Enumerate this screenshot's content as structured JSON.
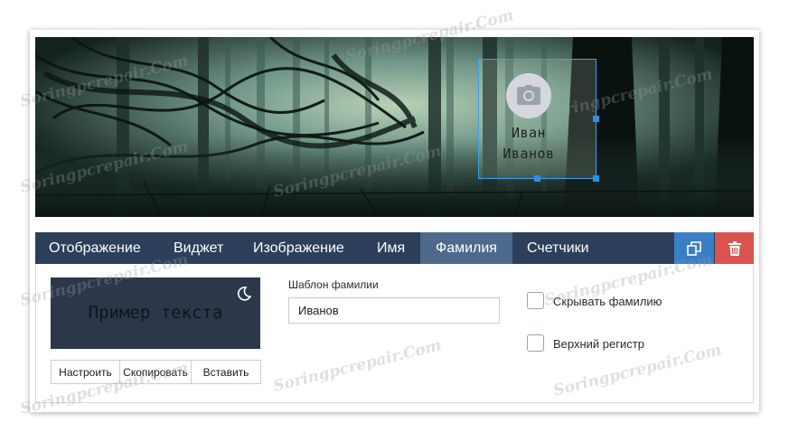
{
  "cover": {
    "first_name": "Иван",
    "last_name": "Иванов",
    "camera_icon": "camera-icon"
  },
  "tabs": [
    {
      "label": "Отображение",
      "active": false
    },
    {
      "label": "Виджет",
      "active": false
    },
    {
      "label": "Изображение",
      "active": false
    },
    {
      "label": "Имя",
      "active": false
    },
    {
      "label": "Фамилия",
      "active": true
    },
    {
      "label": "Счетчики",
      "active": false
    }
  ],
  "actions": {
    "copy_icon": "copy-icon",
    "copy_color": "#3a7ec6",
    "delete_icon": "trash-icon",
    "delete_color": "#d9534f"
  },
  "preview": {
    "text": "Пример текста",
    "theme_icon": "moon-icon"
  },
  "preview_buttons": {
    "configure": "Настроить",
    "copy": "Скопировать",
    "paste": "Вставить"
  },
  "surname_template": {
    "label": "Шаблон фамилии",
    "value": "Иванов"
  },
  "options": {
    "hide_surname": {
      "label": "Скрывать фамилию",
      "checked": false
    },
    "uppercase": {
      "label": "Верхний регистр",
      "checked": false
    }
  },
  "watermark": "Soringpcrepair.Com"
}
